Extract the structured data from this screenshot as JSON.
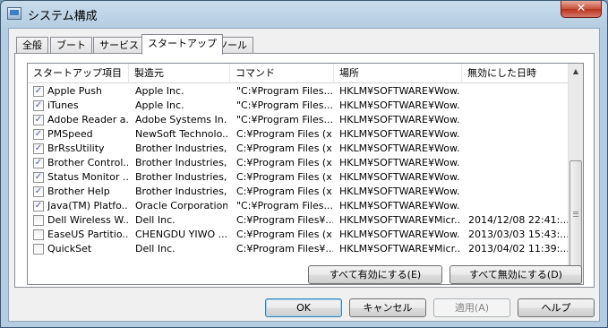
{
  "window": {
    "title": "システム構成",
    "close_label": "✕"
  },
  "tabs": [
    {
      "label": "全般"
    },
    {
      "label": "ブート"
    },
    {
      "label": "サービス"
    },
    {
      "label": "スタートアップ"
    },
    {
      "label": "ツール"
    }
  ],
  "active_tab": "スタートアップ",
  "table": {
    "headers": [
      "スタートアップ項目",
      "製造元",
      "コマンド",
      "場所",
      "無効にした日時"
    ],
    "rows": [
      {
        "checked": true,
        "item": "Apple Push",
        "maker": "Apple Inc.",
        "command": "\"C:¥Program Files...",
        "location": "HKLM¥SOFTWARE¥Wow...",
        "disabled_at": ""
      },
      {
        "checked": true,
        "item": "iTunes",
        "maker": "Apple Inc.",
        "command": "\"C:¥Program Files...",
        "location": "HKLM¥SOFTWARE¥Wow...",
        "disabled_at": ""
      },
      {
        "checked": true,
        "item": "Adobe Reader a...",
        "maker": "Adobe Systems In...",
        "command": "\"C:¥Program Files...",
        "location": "HKLM¥SOFTWARE¥Wow...",
        "disabled_at": ""
      },
      {
        "checked": true,
        "item": "PMSpeed",
        "maker": "NewSoft Technolo...",
        "command": "C:¥Program Files (x...",
        "location": "HKLM¥SOFTWARE¥Wow...",
        "disabled_at": ""
      },
      {
        "checked": true,
        "item": "BrRssUtility",
        "maker": "Brother Industries,...",
        "command": "C:¥Program Files (x...",
        "location": "HKLM¥SOFTWARE¥Wow...",
        "disabled_at": ""
      },
      {
        "checked": true,
        "item": "Brother Control...",
        "maker": "Brother Industries,...",
        "command": "C:¥Program Files (x...",
        "location": "HKLM¥SOFTWARE¥Wow...",
        "disabled_at": ""
      },
      {
        "checked": true,
        "item": "Status Monitor ...",
        "maker": "Brother Industries,...",
        "command": "C:¥Program Files (x...",
        "location": "HKLM¥SOFTWARE¥Wow...",
        "disabled_at": ""
      },
      {
        "checked": true,
        "item": "Brother Help",
        "maker": "Brother Industries,...",
        "command": "C:¥Program Files (x...",
        "location": "HKLM¥SOFTWARE¥Wow...",
        "disabled_at": ""
      },
      {
        "checked": true,
        "item": "Java(TM) Platfo...",
        "maker": "Oracle Corporation",
        "command": "\"C:¥Program Files...",
        "location": "HKLM¥SOFTWARE¥Wow...",
        "disabled_at": ""
      },
      {
        "checked": false,
        "item": "Dell Wireless W...",
        "maker": "Dell Inc.",
        "command": "C:¥Program Files¥...",
        "location": "HKLM¥SOFTWARE¥Micr...",
        "disabled_at": "2014/12/08 22:41:..."
      },
      {
        "checked": false,
        "item": "EaseUS Partitio...",
        "maker": "CHENGDU YIWO ...",
        "command": "C:¥Program Files (x...",
        "location": "HKLM¥SOFTWARE¥Wow...",
        "disabled_at": "2013/03/03 15:43:..."
      },
      {
        "checked": false,
        "item": "QuickSet",
        "maker": "Dell Inc.",
        "command": "C:¥Program Files¥...",
        "location": "HKLM¥SOFTWARE¥Micr...",
        "disabled_at": "2013/04/02 11:39:..."
      }
    ]
  },
  "scrollbar": {
    "up_glyph": "▲",
    "down_glyph": "▼"
  },
  "buttons": {
    "enable_all": "すべて有効にする(E)",
    "disable_all": "すべて無効にする(D)",
    "ok": "OK",
    "cancel": "キャンセル",
    "apply": "適用(A)",
    "help": "ヘルプ"
  },
  "check_glyph": "✓"
}
